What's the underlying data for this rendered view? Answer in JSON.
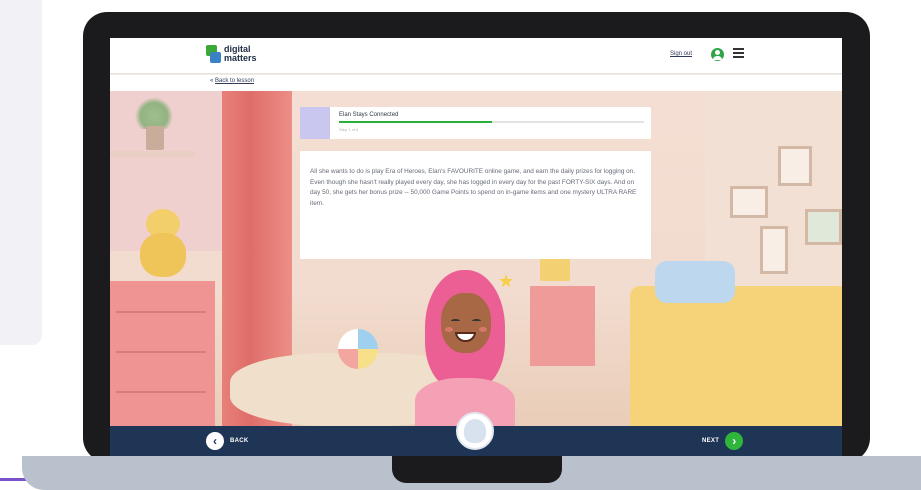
{
  "header": {
    "logo_line1": "digital",
    "logo_line2": "matters",
    "sign_out": "Sign out",
    "back_link_arrow": "«",
    "back_link": "Back to lesson"
  },
  "story": {
    "title": "Elan Stays Connected",
    "progress_fraction": 0.5,
    "step_label": "Step 1 of 6",
    "text": "All she wants to do is play Era of Heroes, Elan's FAVOURITE online game, and earn the daily prizes for logging on. Even though she hasn't really played every day, she has logged in every day for the past FORTY-SIX days. And on day 50, she gets her bonus prize -- 50,000 Game Points to spend on in-game items and one mystery ULTRA RARE item."
  },
  "footer": {
    "back_icon": "‹",
    "back_label": "BACK",
    "next_label": "NEXT",
    "next_icon": "›"
  },
  "icons": {
    "user": "user-circle-icon",
    "menu": "hamburger-menu-icon",
    "star": "★"
  },
  "colors": {
    "progress": "#2aaf3b",
    "footer_bg": "#1f3556",
    "next_button": "#2fb53b",
    "hijab": "#ec5f95"
  }
}
